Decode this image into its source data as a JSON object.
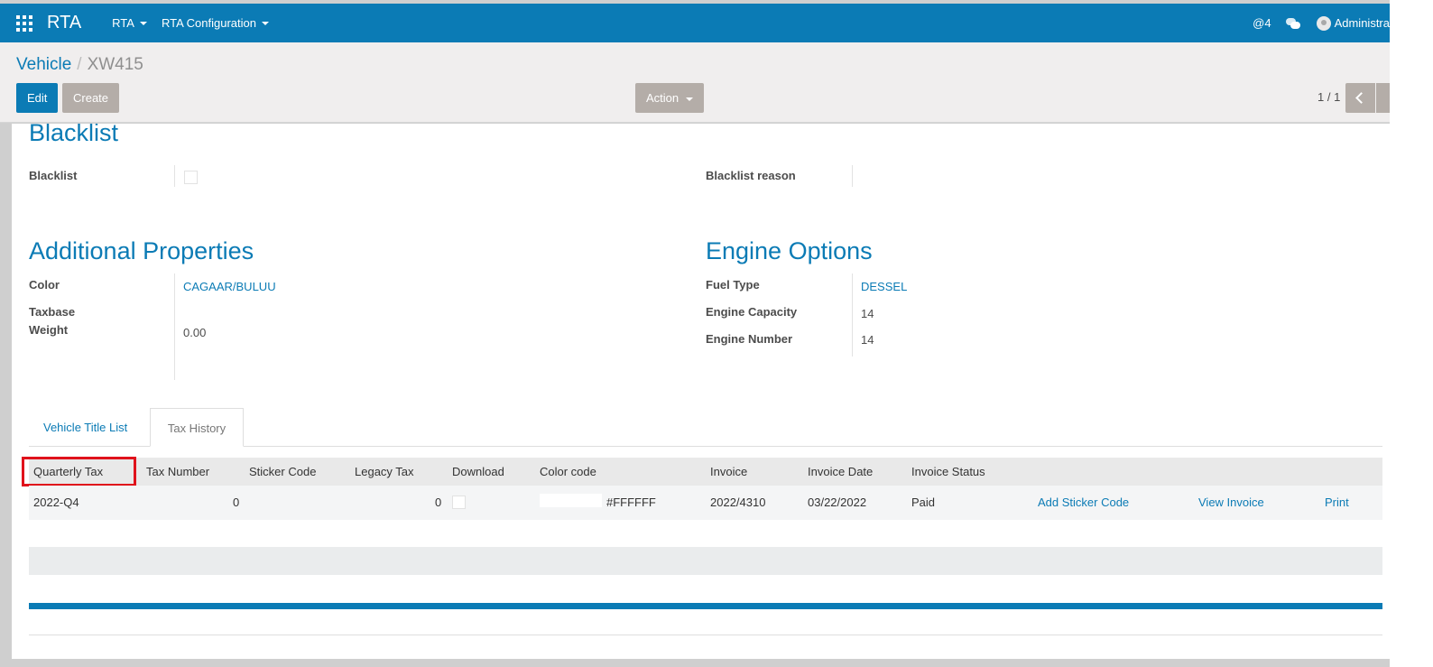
{
  "navbar": {
    "brand": "RTA",
    "menus": [
      {
        "label": "RTA"
      },
      {
        "label": "RTA Configuration"
      }
    ],
    "mentions": "@4",
    "user": "Administra",
    "color": "#0b7bb5"
  },
  "breadcrumb": {
    "parent": "Vehicle",
    "separator": "/",
    "current": "XW415"
  },
  "buttons": {
    "edit": "Edit",
    "create": "Create",
    "action": "Action"
  },
  "pager": {
    "label": "1 / 1"
  },
  "blacklist_section": {
    "title": "Blacklist",
    "blacklist_label": "Blacklist",
    "blacklist_checked": false,
    "reason_label": "Blacklist reason",
    "reason_value": ""
  },
  "additional_properties": {
    "title": "Additional Properties",
    "color_label": "Color",
    "color_value": "CAGAAR/BULUU",
    "taxbase_label_line1": "Taxbase",
    "taxbase_label_line2": "Weight",
    "taxbase_value": "0.00"
  },
  "engine_options": {
    "title": "Engine Options",
    "fuel_label": "Fuel Type",
    "fuel_value": "DESSEL",
    "capacity_label": "Engine Capacity",
    "capacity_value": "14",
    "number_label": "Engine Number",
    "number_value": "14"
  },
  "tabs": [
    {
      "label": "Vehicle Title List",
      "active": false
    },
    {
      "label": "Tax History",
      "active": true
    }
  ],
  "tax_table": {
    "columns": [
      "Quarterly Tax",
      "Tax Number",
      "Sticker Code",
      "Legacy Tax",
      "Download",
      "Color code",
      "Invoice",
      "Invoice Date",
      "Invoice Status"
    ],
    "rows": [
      {
        "quarterly_tax": "2022-Q4",
        "tax_number": "0",
        "sticker_code": "",
        "legacy_tax": "0",
        "download_checked": false,
        "color_code": "#FFFFFF",
        "invoice": "2022/4310",
        "invoice_date": "03/22/2022",
        "invoice_status": "Paid",
        "add_sticker": "Add Sticker Code",
        "view_invoice": "View Invoice",
        "print": "Print"
      }
    ],
    "highlight_color": "#e0121b"
  }
}
